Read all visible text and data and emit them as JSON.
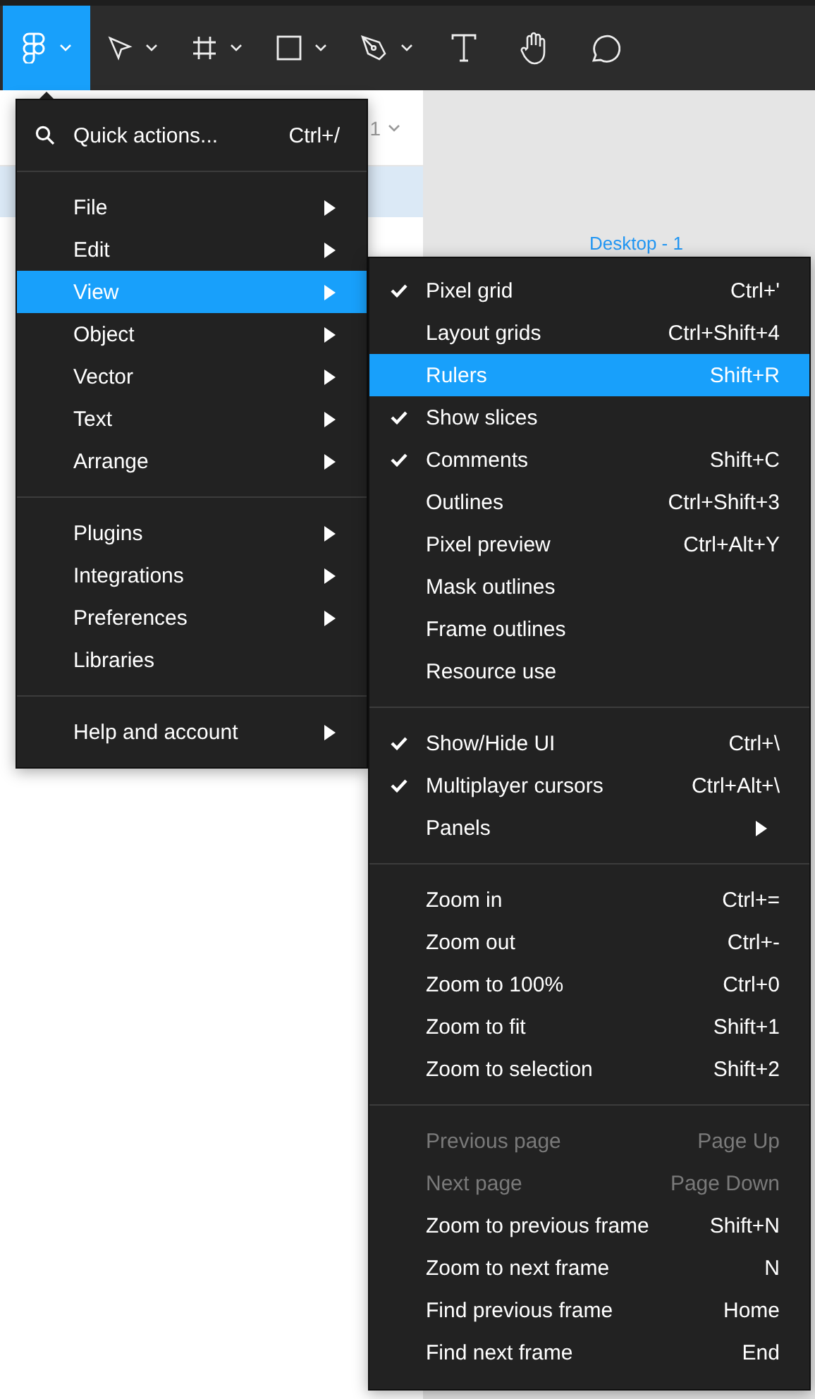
{
  "toolbar": {
    "tools": [
      {
        "kind": "logo",
        "selected": true,
        "dropdown": true
      },
      {
        "kind": "move",
        "selected": false,
        "dropdown": true
      },
      {
        "kind": "frame",
        "selected": false,
        "dropdown": true
      },
      {
        "kind": "shape",
        "selected": false,
        "dropdown": true
      },
      {
        "kind": "pen",
        "selected": false,
        "dropdown": true
      },
      {
        "kind": "text",
        "selected": false,
        "dropdown": false
      },
      {
        "kind": "hand",
        "selected": false,
        "dropdown": false
      },
      {
        "kind": "comment",
        "selected": false,
        "dropdown": false
      }
    ]
  },
  "layers_panel": {
    "page_selector": "1",
    "rows": [
      {
        "selected": true
      }
    ]
  },
  "canvas": {
    "frame_label": "Desktop - 1"
  },
  "main_menu": {
    "items": [
      {
        "kind": "search",
        "label": "Quick actions...",
        "shortcut": "Ctrl+/"
      },
      {
        "kind": "separator"
      },
      {
        "kind": "item",
        "label": "File",
        "submenu": true,
        "selected": false
      },
      {
        "kind": "item",
        "label": "Edit",
        "submenu": true,
        "selected": false
      },
      {
        "kind": "item",
        "label": "View",
        "submenu": true,
        "selected": true
      },
      {
        "kind": "item",
        "label": "Object",
        "submenu": true,
        "selected": false
      },
      {
        "kind": "item",
        "label": "Vector",
        "submenu": true,
        "selected": false
      },
      {
        "kind": "item",
        "label": "Text",
        "submenu": true,
        "selected": false
      },
      {
        "kind": "item",
        "label": "Arrange",
        "submenu": true,
        "selected": false
      },
      {
        "kind": "separator"
      },
      {
        "kind": "item",
        "label": "Plugins",
        "submenu": true,
        "selected": false
      },
      {
        "kind": "item",
        "label": "Integrations",
        "submenu": true,
        "selected": false
      },
      {
        "kind": "item",
        "label": "Preferences",
        "submenu": true,
        "selected": false
      },
      {
        "kind": "item",
        "label": "Libraries",
        "submenu": false,
        "selected": false
      },
      {
        "kind": "separator"
      },
      {
        "kind": "item",
        "label": "Help and account",
        "submenu": true,
        "selected": false
      }
    ]
  },
  "view_submenu": {
    "items": [
      {
        "kind": "item",
        "label": "Pixel grid",
        "shortcut": "Ctrl+'",
        "checked": true,
        "disabled": false,
        "selected": false,
        "submenu": false
      },
      {
        "kind": "item",
        "label": "Layout grids",
        "shortcut": "Ctrl+Shift+4",
        "checked": false,
        "disabled": false,
        "selected": false,
        "submenu": false
      },
      {
        "kind": "item",
        "label": "Rulers",
        "shortcut": "Shift+R",
        "checked": false,
        "disabled": false,
        "selected": true,
        "submenu": false
      },
      {
        "kind": "item",
        "label": "Show slices",
        "checked": true,
        "disabled": false,
        "selected": false,
        "submenu": false
      },
      {
        "kind": "item",
        "label": "Comments",
        "shortcut": "Shift+C",
        "checked": true,
        "disabled": false,
        "selected": false,
        "submenu": false
      },
      {
        "kind": "item",
        "label": "Outlines",
        "shortcut": "Ctrl+Shift+3",
        "checked": false,
        "disabled": false,
        "selected": false,
        "submenu": false
      },
      {
        "kind": "item",
        "label": "Pixel preview",
        "shortcut": "Ctrl+Alt+Y",
        "checked": false,
        "disabled": false,
        "selected": false,
        "submenu": false
      },
      {
        "kind": "item",
        "label": "Mask outlines",
        "checked": false,
        "disabled": false,
        "selected": false,
        "submenu": false
      },
      {
        "kind": "item",
        "label": "Frame outlines",
        "checked": false,
        "disabled": false,
        "selected": false,
        "submenu": false
      },
      {
        "kind": "item",
        "label": "Resource use",
        "checked": false,
        "disabled": false,
        "selected": false,
        "submenu": false
      },
      {
        "kind": "separator"
      },
      {
        "kind": "item",
        "label": "Show/Hide UI",
        "shortcut": "Ctrl+\\",
        "checked": true,
        "disabled": false,
        "selected": false,
        "submenu": false
      },
      {
        "kind": "item",
        "label": "Multiplayer cursors",
        "shortcut": "Ctrl+Alt+\\",
        "checked": true,
        "disabled": false,
        "selected": false,
        "submenu": false
      },
      {
        "kind": "item",
        "label": "Panels",
        "checked": false,
        "disabled": false,
        "selected": false,
        "submenu": true
      },
      {
        "kind": "separator"
      },
      {
        "kind": "item",
        "label": "Zoom in",
        "shortcut": "Ctrl+=",
        "checked": false,
        "disabled": false,
        "selected": false,
        "submenu": false
      },
      {
        "kind": "item",
        "label": "Zoom out",
        "shortcut": "Ctrl+-",
        "checked": false,
        "disabled": false,
        "selected": false,
        "submenu": false
      },
      {
        "kind": "item",
        "label": "Zoom to 100%",
        "shortcut": "Ctrl+0",
        "checked": false,
        "disabled": false,
        "selected": false,
        "submenu": false
      },
      {
        "kind": "item",
        "label": "Zoom to fit",
        "shortcut": "Shift+1",
        "checked": false,
        "disabled": false,
        "selected": false,
        "submenu": false
      },
      {
        "kind": "item",
        "label": "Zoom to selection",
        "shortcut": "Shift+2",
        "checked": false,
        "disabled": false,
        "selected": false,
        "submenu": false
      },
      {
        "kind": "separator"
      },
      {
        "kind": "item",
        "label": "Previous page",
        "shortcut": "Page Up",
        "checked": false,
        "disabled": true,
        "selected": false,
        "submenu": false
      },
      {
        "kind": "item",
        "label": "Next page",
        "shortcut": "Page Down",
        "checked": false,
        "disabled": true,
        "selected": false,
        "submenu": false
      },
      {
        "kind": "item",
        "label": "Zoom to previous frame",
        "shortcut": "Shift+N",
        "checked": false,
        "disabled": false,
        "selected": false,
        "submenu": false
      },
      {
        "kind": "item",
        "label": "Zoom to next frame",
        "shortcut": "N",
        "checked": false,
        "disabled": false,
        "selected": false,
        "submenu": false
      },
      {
        "kind": "item",
        "label": "Find previous frame",
        "shortcut": "Home",
        "checked": false,
        "disabled": false,
        "selected": false,
        "submenu": false
      },
      {
        "kind": "item",
        "label": "Find next frame",
        "shortcut": "End",
        "checked": false,
        "disabled": false,
        "selected": false,
        "submenu": false
      }
    ]
  }
}
